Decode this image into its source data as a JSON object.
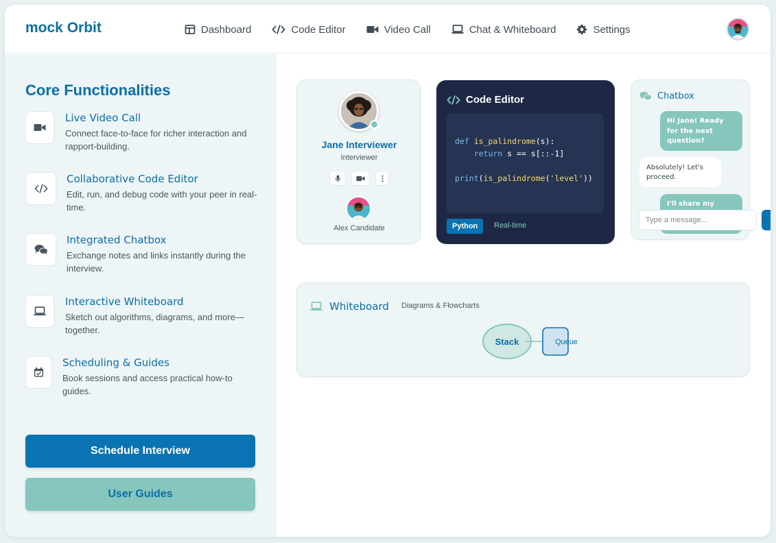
{
  "header": {
    "brand": "mock Orbit",
    "nav": [
      {
        "label": "Dashboard",
        "icon": "layout-icon"
      },
      {
        "label": "Code Editor",
        "icon": "code-icon"
      },
      {
        "label": "Video Call",
        "icon": "video-icon"
      },
      {
        "label": "Chat & Whiteboard",
        "icon": "laptop-icon"
      },
      {
        "label": "Settings",
        "icon": "gear-icon"
      }
    ]
  },
  "sidebar": {
    "title": "Core Functionalities",
    "features": [
      {
        "title": "Live Video Call",
        "desc": "Connect face-to-face for richer interaction and rapport-building.",
        "icon": "video-icon"
      },
      {
        "title": "Collaborative Code Editor",
        "desc": "Edit, run, and debug code with your peer in real-time.",
        "icon": "code-icon"
      },
      {
        "title": "Integrated Chatbox",
        "desc": "Exchange notes and links instantly during the interview.",
        "icon": "chat-icon"
      },
      {
        "title": "Interactive Whiteboard",
        "desc": "Sketch out algorithms, diagrams, and more—together.",
        "icon": "laptop-icon"
      },
      {
        "title": "Scheduling & Guides",
        "desc": "Book sessions and access practical how-to guides.",
        "icon": "calendar-check-icon"
      }
    ],
    "primary_button": "Schedule Interview",
    "secondary_button": "User Guides"
  },
  "profile": {
    "name": "Jane Interviewer",
    "role": "Interviewer",
    "candidate": "Alex Candidate"
  },
  "code_editor": {
    "title": "Code Editor",
    "language": "Python",
    "mode": "Real-time"
  },
  "chat": {
    "title": "Chatbox",
    "messages": [
      {
        "text": "Hi Jane! Ready for the next question?"
      },
      {
        "text": "Absolutely! Let's proceed."
      },
      {
        "text": "I'll share my"
      }
    ],
    "input_placeholder": "Type a message..."
  },
  "whiteboard": {
    "title": "Whiteboard",
    "subtitle": "Diagrams & Flowcharts",
    "nodes": [
      "Stack",
      "Queue"
    ]
  },
  "colors": {
    "brand": "#0b6ea9",
    "primary": "#0a73b3",
    "accent": "#86c6bd",
    "code_bg": "#1d2944"
  }
}
